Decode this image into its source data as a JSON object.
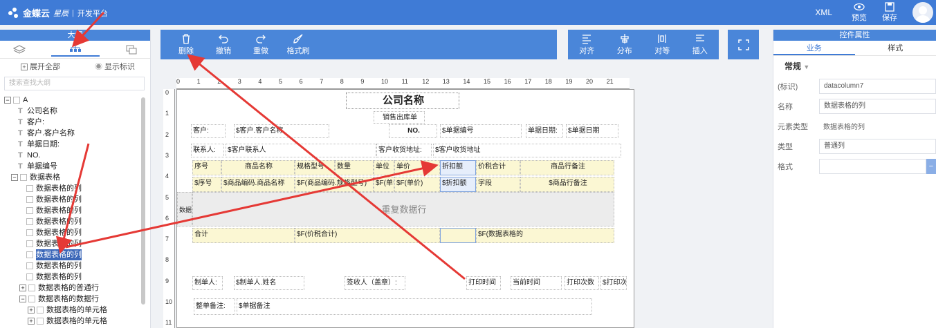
{
  "header": {
    "brand": "金蝶云",
    "brand_sub": "星辰",
    "platform": "开发平台",
    "xml_label": "XML",
    "preview_label": "预览",
    "save_label": "保存"
  },
  "left_panel": {
    "title": "大纲",
    "expand_all": "展开全部",
    "show_marks": "显示标识",
    "search_placeholder": "搜索查找大纲",
    "tree": {
      "root": "A",
      "items": [
        "公司名称",
        "客户:",
        "客户.客户名称",
        "单据日期:",
        "NO.",
        "单据编号"
      ],
      "table": "数据表格",
      "columns": [
        "数据表格的列",
        "数据表格的列",
        "数据表格的列",
        "数据表格的列",
        "数据表格的列",
        "数据表格的列",
        "数据表格的列",
        "数据表格的列",
        "数据表格的列",
        "数据表格的列"
      ],
      "normal_row": "数据表格的普通行",
      "data_row": "数据表格的数据行",
      "cell1": "数据表格的单元格",
      "cell2": "数据表格的单元格"
    }
  },
  "toolbar": {
    "delete": "删除",
    "undo": "撤销",
    "redo": "重做",
    "format_brush": "格式刷",
    "align": "对齐",
    "distribute": "分布",
    "equal": "对等",
    "insert": "插入"
  },
  "ruler": {
    "top": [
      "0",
      "1",
      "2",
      "3",
      "4",
      "5",
      "6",
      "7",
      "8",
      "9",
      "10",
      "11",
      "12",
      "13",
      "14",
      "15",
      "16",
      "17",
      "18",
      "19",
      "20",
      "21"
    ],
    "left": [
      "0",
      "1",
      "2",
      "3",
      "4",
      "5",
      "6",
      "7",
      "8",
      "9",
      "10",
      "11"
    ]
  },
  "report": {
    "company": "公司名称",
    "doc_title": "销售出库单",
    "customer_label": "客户:",
    "customer_value": "$客户.客户名称",
    "no_label": "NO.",
    "no_value": "$单据编号",
    "date_label": "单据日期:",
    "date_value": "$单据日期",
    "contact_label": "联系人:",
    "contact_value": "$客户联系人",
    "address_label": "客户收货地址:",
    "address_value": "$客户收货地址",
    "headers": [
      "序号",
      "商品名称",
      "规格型号",
      "数量",
      "单位",
      "单价",
      "折扣额",
      "价税合计",
      "商品行备注"
    ],
    "data_cells": [
      "$序号",
      "$商品编码.商品名称",
      "$F(商品编码.规格型号)",
      "$F(单位)",
      "$F(单价)",
      "$折扣额",
      "字段",
      "$商品行备注"
    ],
    "data_label": "数据",
    "repeat_row": "重复数据行",
    "total_label": "合计",
    "total_sum": "$F(价税合计)",
    "total_col": "$F(数据表格的",
    "maker_label": "制单人:",
    "maker_value": "$制单人.姓名",
    "sign_label": "签收人（盖章）:",
    "print_time": "打印时间",
    "current_time": "当前时间",
    "print_count": "打印次数",
    "print_more": "$打印次",
    "remark_label": "整单备注:",
    "remark_value": "$单据备注"
  },
  "right_panel": {
    "title": "控件属性",
    "tab_business": "业务",
    "tab_style": "样式",
    "section": "常规",
    "fields": {
      "id_label": "(标识)",
      "id_value": "datacolumn7",
      "name_label": "名称",
      "name_value": "数据表格的列",
      "type_elem_label": "元素类型",
      "type_elem_value": "数据表格的列",
      "type_label": "类型",
      "type_value": "普通列",
      "format_label": "格式",
      "format_value": ""
    }
  }
}
